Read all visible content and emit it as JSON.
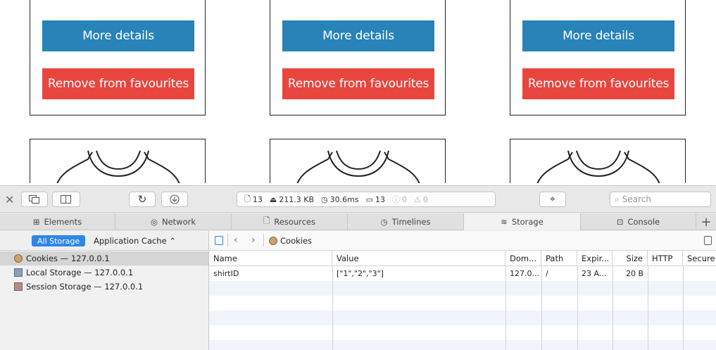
{
  "page": {
    "cards": [
      {
        "more_label": "More details",
        "remove_label": "Remove from favourites"
      },
      {
        "more_label": "More details",
        "remove_label": "Remove from favourites"
      },
      {
        "more_label": "More details",
        "remove_label": "Remove from favourites"
      }
    ],
    "colors": {
      "more": "#2783b8",
      "remove": "#e9453f"
    }
  },
  "devtools": {
    "stats": {
      "resources": "13",
      "size": "211.3 KB",
      "time": "30.6ms",
      "logs": "13",
      "errors": "0",
      "warnings": "0"
    },
    "search_placeholder": "Search",
    "tabs": [
      {
        "label": "Elements",
        "icon": "elements-icon"
      },
      {
        "label": "Network",
        "icon": "network-icon"
      },
      {
        "label": "Resources",
        "icon": "resources-icon"
      },
      {
        "label": "Timelines",
        "icon": "timelines-icon"
      },
      {
        "label": "Storage",
        "icon": "storage-icon",
        "active": true
      },
      {
        "label": "Console",
        "icon": "console-icon"
      }
    ],
    "sidebar": {
      "filter_all": "All Storage",
      "filter_cache": "Application Cache",
      "items": [
        {
          "label": "Cookies — 127.0.0.1",
          "icon": "cookie-icon",
          "selected": true
        },
        {
          "label": "Local Storage — 127.0.0.1",
          "icon": "table-icon"
        },
        {
          "label": "Session Storage — 127.0.0.1",
          "icon": "table-icon"
        }
      ]
    },
    "breadcrumb": "Cookies",
    "columns": [
      "Name",
      "Value",
      "Dom...",
      "Path",
      "Expir...",
      "Size",
      "HTTP",
      "Secure"
    ],
    "rows": [
      {
        "name": "shirtID",
        "value": "[\"1\",\"2\",\"3\"]",
        "domain": "127.0...",
        "path": "/",
        "expires": "23 A...",
        "size": "20 B",
        "http": "",
        "secure": ""
      }
    ]
  }
}
